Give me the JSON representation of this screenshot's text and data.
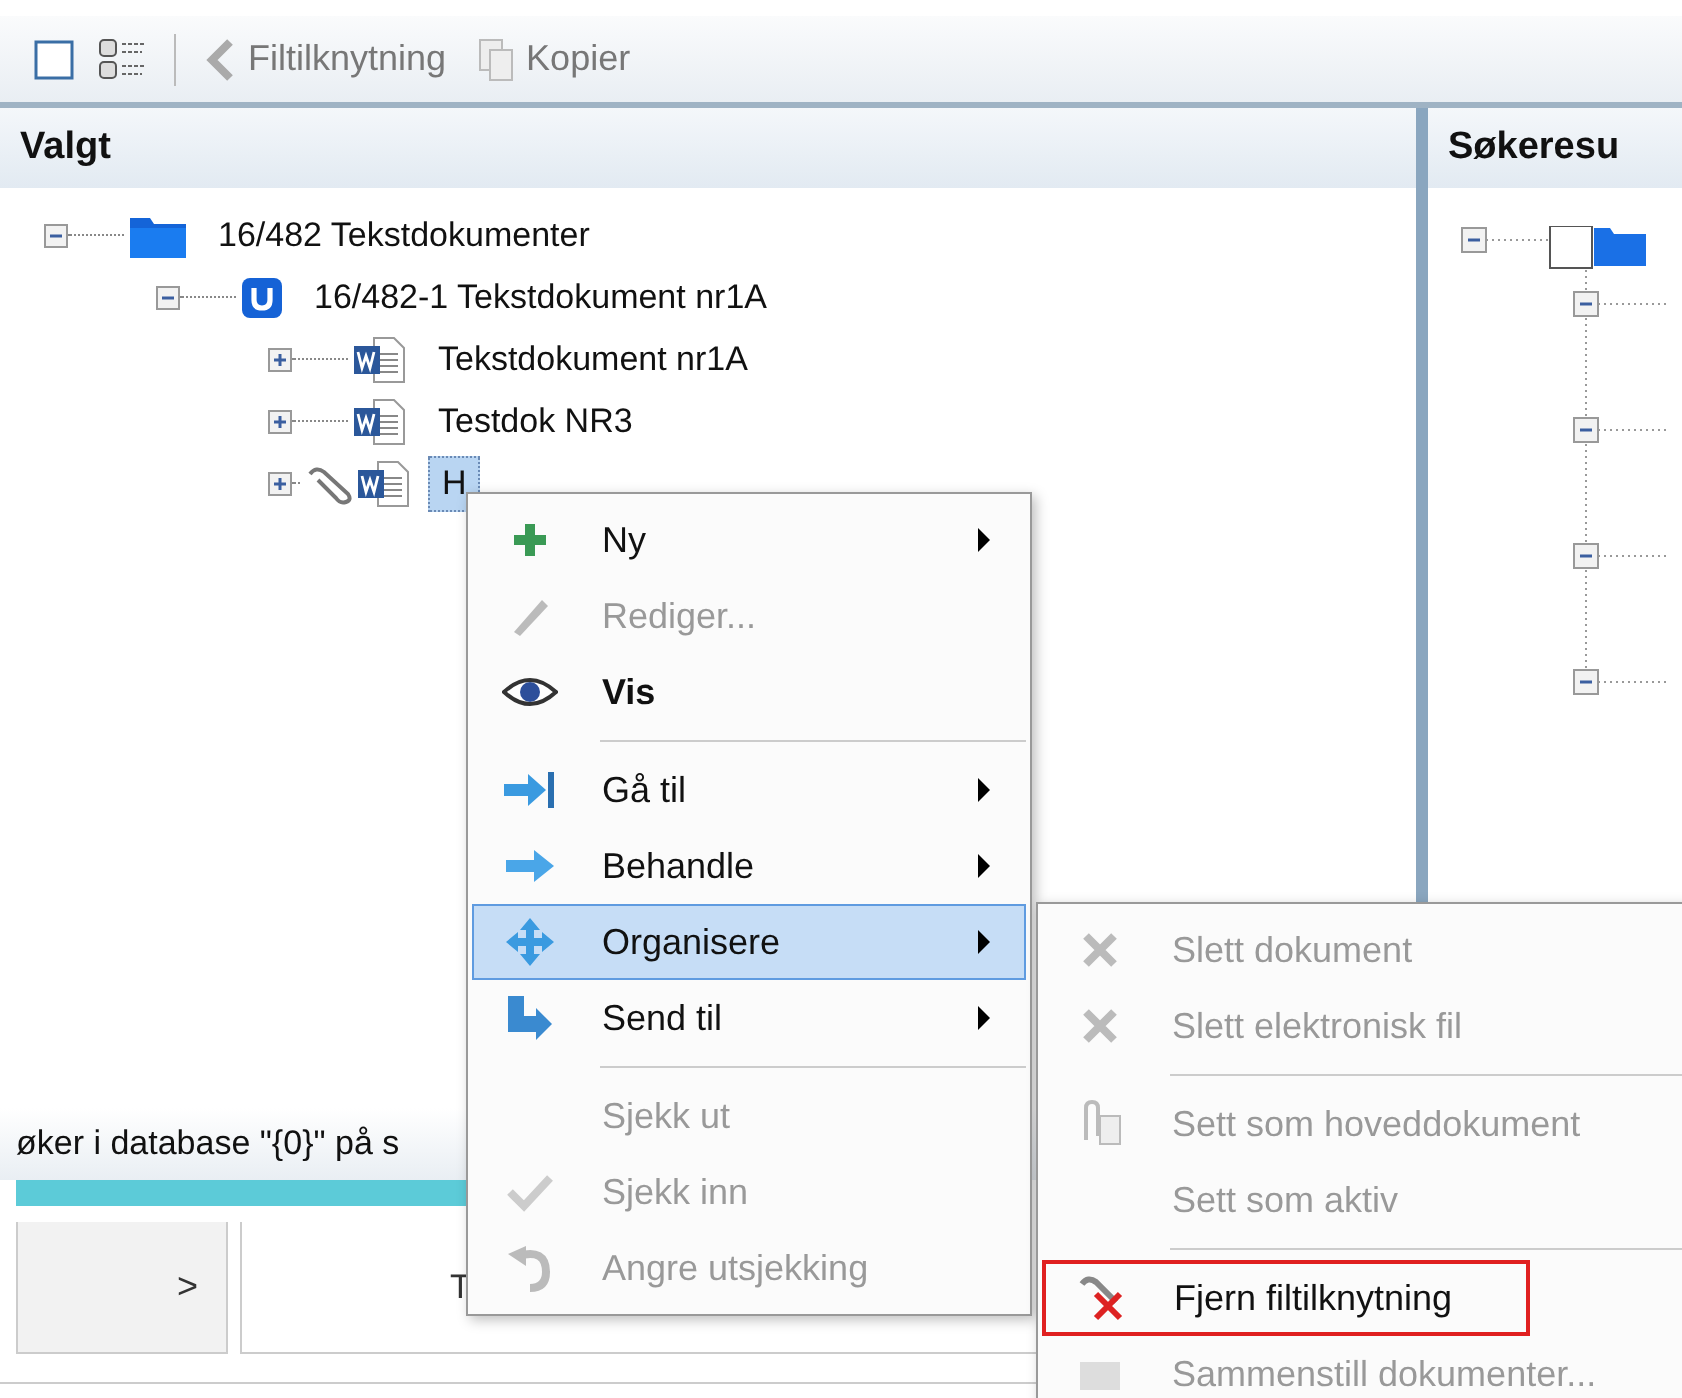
{
  "toolbar": {
    "buttons": [
      {
        "label": "Filtilknytning",
        "disabled": true
      },
      {
        "label": "Kopier",
        "disabled": true
      }
    ]
  },
  "left_pane": {
    "title": "Valgt",
    "tree": [
      {
        "label": "16/482 Tekstdokumenter",
        "expanded": true,
        "selected": false,
        "children": [
          {
            "label": "16/482-1 Tekstdokument nr1A",
            "expanded": true,
            "selected": false,
            "children": [
              {
                "label": "Tekstdokument nr1A",
                "expanded": false,
                "selected": false,
                "attachment": false
              },
              {
                "label": "Testdok NR3",
                "expanded": false,
                "selected": false,
                "attachment": false
              },
              {
                "label": "H",
                "expanded": false,
                "selected": true,
                "attachment": true
              }
            ]
          }
        ]
      }
    ]
  },
  "right_pane": {
    "title": "Søkeresu"
  },
  "status_bar": {
    "text": "øker i database \"{0}\" på s"
  },
  "bottom_panel": {
    "nav": ">",
    "column_1": "T"
  },
  "context_menu": {
    "items": [
      {
        "kind": "item",
        "label": "Ny",
        "disabled": false,
        "bold": false,
        "submenu": true,
        "selected": false
      },
      {
        "kind": "item",
        "label": "Rediger...",
        "disabled": true,
        "bold": false,
        "submenu": false,
        "selected": false
      },
      {
        "kind": "item",
        "label": "Vis",
        "disabled": false,
        "bold": true,
        "submenu": false,
        "selected": false
      },
      {
        "kind": "separator"
      },
      {
        "kind": "item",
        "label": "Gå til",
        "disabled": false,
        "bold": false,
        "submenu": true,
        "selected": false
      },
      {
        "kind": "item",
        "label": "Behandle",
        "disabled": false,
        "bold": false,
        "submenu": true,
        "selected": false
      },
      {
        "kind": "item",
        "label": "Organisere",
        "disabled": false,
        "bold": false,
        "submenu": true,
        "selected": true
      },
      {
        "kind": "item",
        "label": "Send til",
        "disabled": false,
        "bold": false,
        "submenu": true,
        "selected": false
      },
      {
        "kind": "separator"
      },
      {
        "kind": "item",
        "label": "Sjekk ut",
        "disabled": true,
        "bold": false,
        "submenu": false,
        "selected": false
      },
      {
        "kind": "item",
        "label": "Sjekk inn",
        "disabled": true,
        "bold": false,
        "submenu": false,
        "selected": false
      },
      {
        "kind": "item",
        "label": "Angre utsjekking",
        "disabled": true,
        "bold": false,
        "submenu": false,
        "selected": false
      }
    ]
  },
  "submenu": {
    "items": [
      {
        "kind": "item",
        "label": "Slett dokument",
        "disabled": true,
        "selected": false
      },
      {
        "kind": "item",
        "label": "Slett elektronisk fil",
        "disabled": true,
        "selected": false
      },
      {
        "kind": "separator"
      },
      {
        "kind": "item",
        "label": "Sett som hoveddokument",
        "disabled": true,
        "selected": false
      },
      {
        "kind": "item",
        "label": "Sett som aktiv",
        "disabled": true,
        "selected": false
      },
      {
        "kind": "separator"
      },
      {
        "kind": "item",
        "label": "Fjern filtilknytning",
        "disabled": false,
        "selected": true
      },
      {
        "kind": "item",
        "label": "Sammenstill dokumenter...",
        "disabled": true,
        "selected": false
      }
    ]
  }
}
